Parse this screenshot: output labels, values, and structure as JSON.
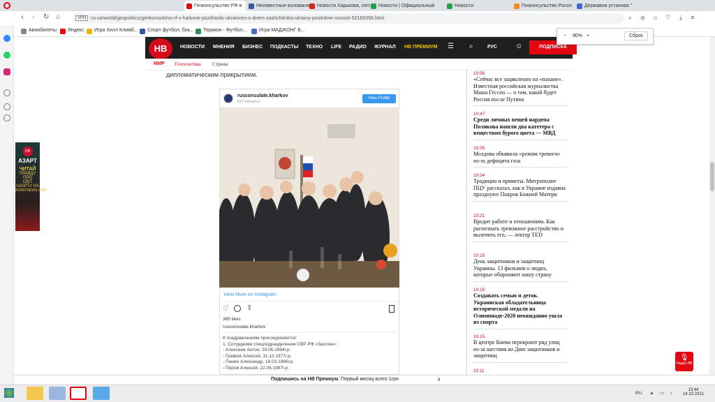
{
  "browser": {
    "tabs": [
      {
        "label": "Генконсульство РФ в",
        "active": true,
        "color": "#e30613"
      },
      {
        "label": "Неизвестные взломали",
        "active": false,
        "color": "#3b5998"
      },
      {
        "label": "Новости Харькова, сегод",
        "active": false,
        "color": "#d6261b"
      },
      {
        "label": "Новости | Официальный",
        "active": false,
        "color": "#22a04b"
      },
      {
        "label": "Новости",
        "active": false,
        "color": "#22a04b"
      },
      {
        "label": "Генконсульство Росси",
        "active": false,
        "color": "#f08a24"
      },
      {
        "label": "Державна установа \"",
        "active": false,
        "color": "#3e68d6"
      }
    ],
    "url": "nv.ua/world/geopolitics/genkonsulstvo-rf-v-harkove-pozdravilo-ukraincev-s-dnem-zashchitnika-ukrainy-poslednie-novosti-50189356.html",
    "vpn": "VPN",
    "bookmarks": [
      "Авиабилеты",
      "Яндекс",
      "Игра Хилл Климб...",
      "Спорт футбол, бок...",
      "Терикон - Футбол...",
      "Игра МАДЖОНГ Б..."
    ],
    "zoom": {
      "minus": "−",
      "value": "90%",
      "plus": "+",
      "reset": "Сброс"
    }
  },
  "site": {
    "logo": "НВ",
    "nav": [
      "НОВОСТИ",
      "МНЕНИЯ",
      "БИЗНЕС",
      "ПОДКАСТЫ",
      "ТЕХНО",
      "LIFE",
      "РАДИО",
      "ЖУРНАЛ",
      "НВ ПРЕМИУМ"
    ],
    "lang": "РУС",
    "subscribe": "ПОДПИСКА",
    "subnav": [
      "МИР",
      "Геополитика",
      "Страны"
    ]
  },
  "article": {
    "text": "дипломатическим прикрытием."
  },
  "instagram": {
    "account": "rusconsulate.kharkov",
    "followers": "537 followers",
    "view_profile": "View Profile",
    "view_more": "View More on Instagram",
    "likes": "385 likes",
    "caption_user": "rusconsulate.kharkov",
    "caption_lines": [
      "К поздравлениям присоединяются:",
      "1. Сотрудники спецподразделения СВР РФ «Заслон»:",
      "- Алексеев Антон, 29.06.1994г.р.",
      "- Графов Алексей, 31.12.1977г.р.",
      "- Панин Александр, 18.03.1986г.р.",
      "- Перов Алексей, 22.06.1987г.р."
    ]
  },
  "news": [
    {
      "time": "10:56",
      "headline": "«Сейчас все зацикленно на «пахане». Известная российская журналистка Маша Гессен — о том, какой будет Россия после Путина",
      "bold": false
    },
    {
      "time": "10:47",
      "headline": "Среди личных вещей нардепа Полякова нашли два катетера с веществом бурого цвета — МВД",
      "bold": true
    },
    {
      "time": "10:35",
      "headline": "Молдова объявила «режим тревоги» из-за дефицита газа",
      "bold": false
    },
    {
      "time": "10:34",
      "headline": "Традиции и приметы. Митрополит ПЦУ рассказал, как в Украине издавна празднуют Покров Божией Матери",
      "bold": false
    },
    {
      "time": "10:21",
      "headline": "Вредит работе и отношениям. Как распознать тревожное расстройство и вылечить его, — лектор TED",
      "bold": false
    },
    {
      "time": "10:15",
      "headline": "День защитников и защитниц Украины. 13 фильмов о людях, которые обороняют нашу страну",
      "bold": false
    },
    {
      "time": "10:15",
      "headline": "Создавать семью и деток. Украинская обладательница исторической медали на Олимпиаде-2020 неожиданно ушла из спорта",
      "bold": true
    },
    {
      "time": "10:15",
      "headline": "В центре Киева перекроют ряд улиц из-за шествия ко Дню защитников и защитниц",
      "bold": false
    },
    {
      "time": "10:11",
      "headline": "",
      "bold": false
    }
  ],
  "banner": {
    "lines": [
      "АЗАРТ",
      "ЧИТАЙ",
      "ПРАВДУ ПРО",
      "СВІТ АЗАРТУ НА",
      "AZARTNEWS.COM"
    ]
  },
  "premium_strip": {
    "bold": "Подпишись на НВ Премиум.",
    "rest": " Первый месяц всего 1грн",
    "arrow": "›"
  },
  "radio": {
    "label": "Радио НВ"
  },
  "taskbar": {
    "lang": "RU",
    "time": "13:44",
    "date": "14.10.2021"
  },
  "colors": {
    "brand": "#e30613",
    "nav_bg": "#1f1f1f",
    "ig_blue": "#3897f0"
  }
}
